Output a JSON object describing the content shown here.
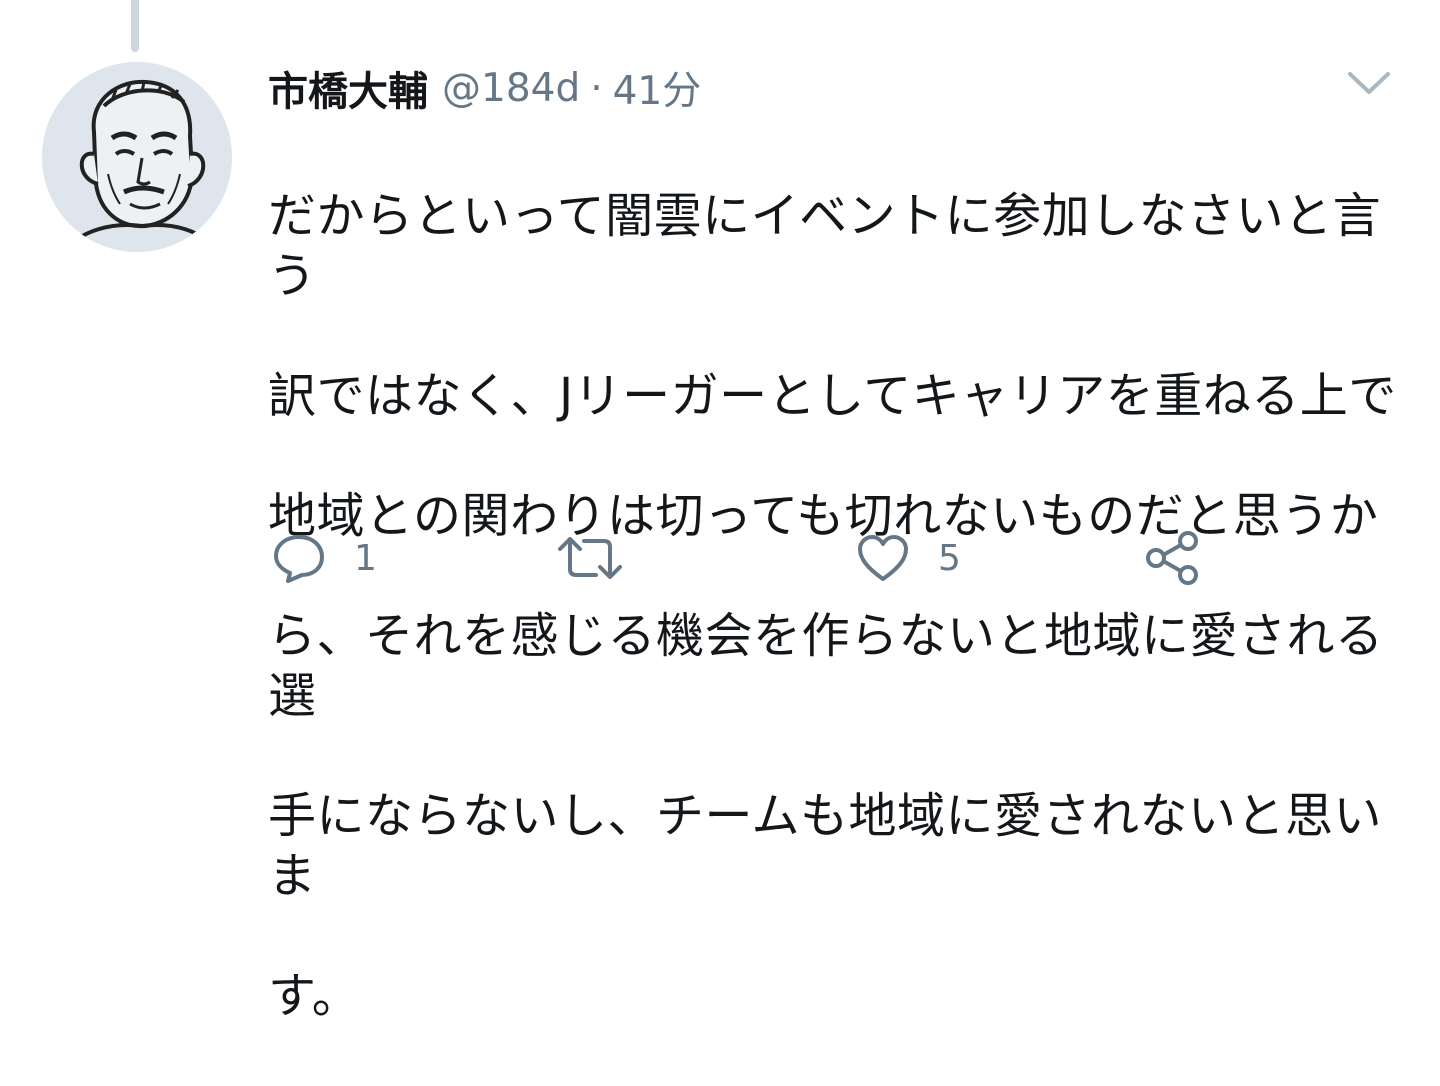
{
  "tweet": {
    "author": {
      "display_name": "市橋大輔",
      "handle": "@184d",
      "avatar": "sketch-portrait-avatar"
    },
    "separator": "·",
    "time_ago": "41分",
    "text_lines": [
      "だからといって闇雲にイベントに参加しなさいと言う",
      "訳ではなく、Jリーガーとしてキャリアを重ねる上で",
      "地域との関わりは切っても切れないものだと思うか",
      "ら、それを感じる機会を作らないと地域に愛される選",
      "手にならないし、チームも地域に愛されないと思いま",
      "す。"
    ],
    "actions": {
      "reply": {
        "icon": "reply-icon",
        "count": "1"
      },
      "retweet": {
        "icon": "retweet-icon",
        "count": ""
      },
      "like": {
        "icon": "heart-icon",
        "count": "5"
      },
      "share": {
        "icon": "share-icon"
      }
    },
    "menu_icon": "chevron-down-icon"
  },
  "colors": {
    "text": "#14171a",
    "secondary": "#657786",
    "thread_line": "#ccd6dd",
    "chevron": "#aab8c2"
  }
}
